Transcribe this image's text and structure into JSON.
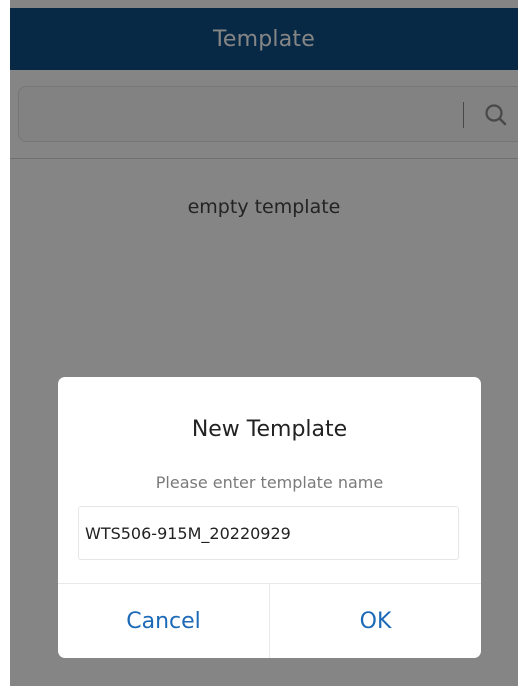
{
  "header": {
    "title": "Template"
  },
  "search": {
    "placeholder": ""
  },
  "main": {
    "empty_text": "empty template"
  },
  "dialog": {
    "title": "New Template",
    "subtitle": "Please enter template name",
    "input_value": "WTS506-915M_20220929",
    "cancel_label": "Cancel",
    "ok_label": "OK"
  },
  "colors": {
    "header_bg": "#0f4f85",
    "accent": "#1b69b7",
    "overlay": "rgba(0,0,0,0.48)"
  },
  "icons": {
    "search": "search-icon"
  }
}
